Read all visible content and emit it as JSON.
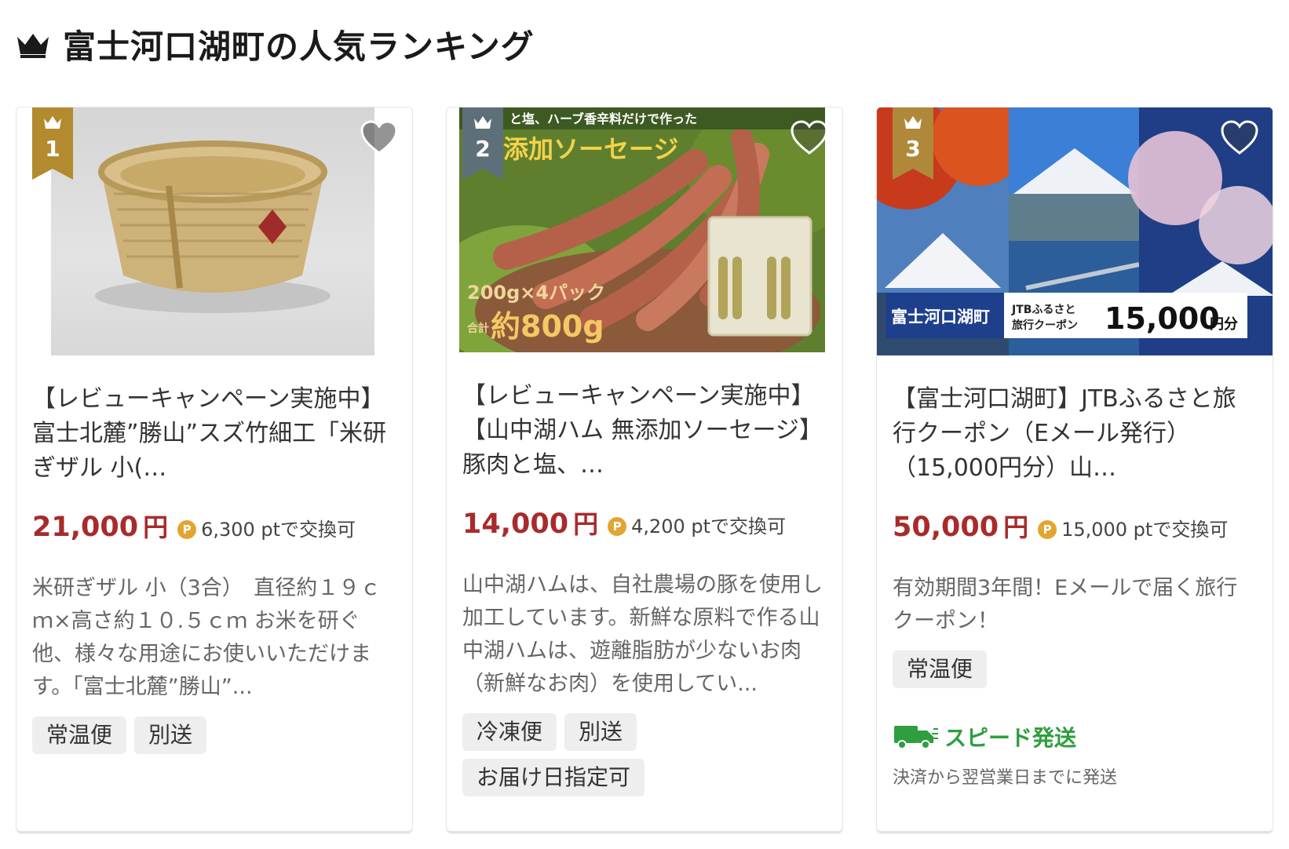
{
  "section": {
    "title": "富士河口湖町の人気ランキング",
    "crown_icon": "crown-icon"
  },
  "colors": {
    "price": "#a82b2b",
    "rank1_badge": "#b38a2d",
    "rank2_badge": "#5d6f78",
    "rank3_badge": "#b0883a",
    "points_icon": "#e3a532",
    "speed_green": "#2e9e3e"
  },
  "products": [
    {
      "rank": "1",
      "title": "【レビューキャンペーン実施中】富士北麓”勝山”スズ竹細工「米研ぎザル 小(…",
      "price": "21,000",
      "yen": "円",
      "points_icon": "P",
      "points": "6,300 ptで交換可",
      "description": "米研ぎザル 小（3合）　直径約１９ｃｍ×高さ約１０.５ｃｍ お米を研ぐ他、様々な用途にお使いいただけます。「富士北麓”勝山”...",
      "tags": [
        "常温便",
        "別送"
      ]
    },
    {
      "rank": "2",
      "title": "【レビューキャンペーン実施中】【山中湖ハム 無添加ソーセージ】豚肉と塩、…",
      "price": "14,000",
      "yen": "円",
      "points_icon": "P",
      "points": "4,200 ptで交換可",
      "description": "山中湖ハムは、自社農場の豚を使用し加工しています。新鮮な原料で作る山中湖ハムは、遊離脂肪が少ないお肉（新鮮なお肉）を使用してい...",
      "tags": [
        "冷凍便",
        "別送",
        "お届け日指定可"
      ],
      "image_text": {
        "top": "と塩、ハーブ香辛料だけで作った",
        "banner": "添加ソーセージ",
        "pack": "200g×4パック",
        "total_prefix": "合計",
        "total": "約800g"
      }
    },
    {
      "rank": "3",
      "title": "【富士河口湖町】JTBふるさと旅行クーポン（Eメール発行）（15,000円分）山…",
      "price": "50,000",
      "yen": "円",
      "points_icon": "P",
      "points": "15,000 ptで交換可",
      "description": "有効期間3年間！Eメールで届く旅行クーポン！",
      "tags": [
        "常温便"
      ],
      "image_text": {
        "town": "富士河口湖町",
        "jtb_line1": "JTBふるさと",
        "jtb_line2": "旅行クーポン",
        "amount": "15,000",
        "amount_unit": "円分"
      },
      "speed_label": "スピード発送",
      "speed_note": "決済から翌営業日までに発送"
    }
  ]
}
